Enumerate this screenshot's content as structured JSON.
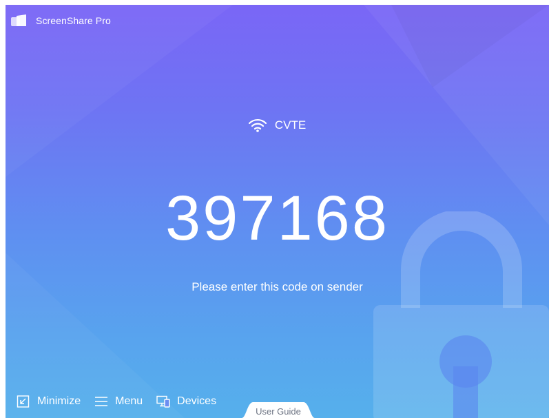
{
  "app": {
    "title": "ScreenShare Pro",
    "logo_icon": "screenshare-logo-icon"
  },
  "network": {
    "icon": "wifi-icon",
    "name": "CVTE"
  },
  "pairing": {
    "code": "397168",
    "instruction": "Please enter this code on sender"
  },
  "toolbar": {
    "minimize_label": "Minimize",
    "menu_label": "Menu",
    "devices_label": "Devices",
    "user_guide_label": "User Guide"
  },
  "colors": {
    "gradient_top": "#7a66f6",
    "gradient_bottom": "#56b0ec",
    "text": "#ffffff",
    "user_guide_text": "#6e7584"
  }
}
